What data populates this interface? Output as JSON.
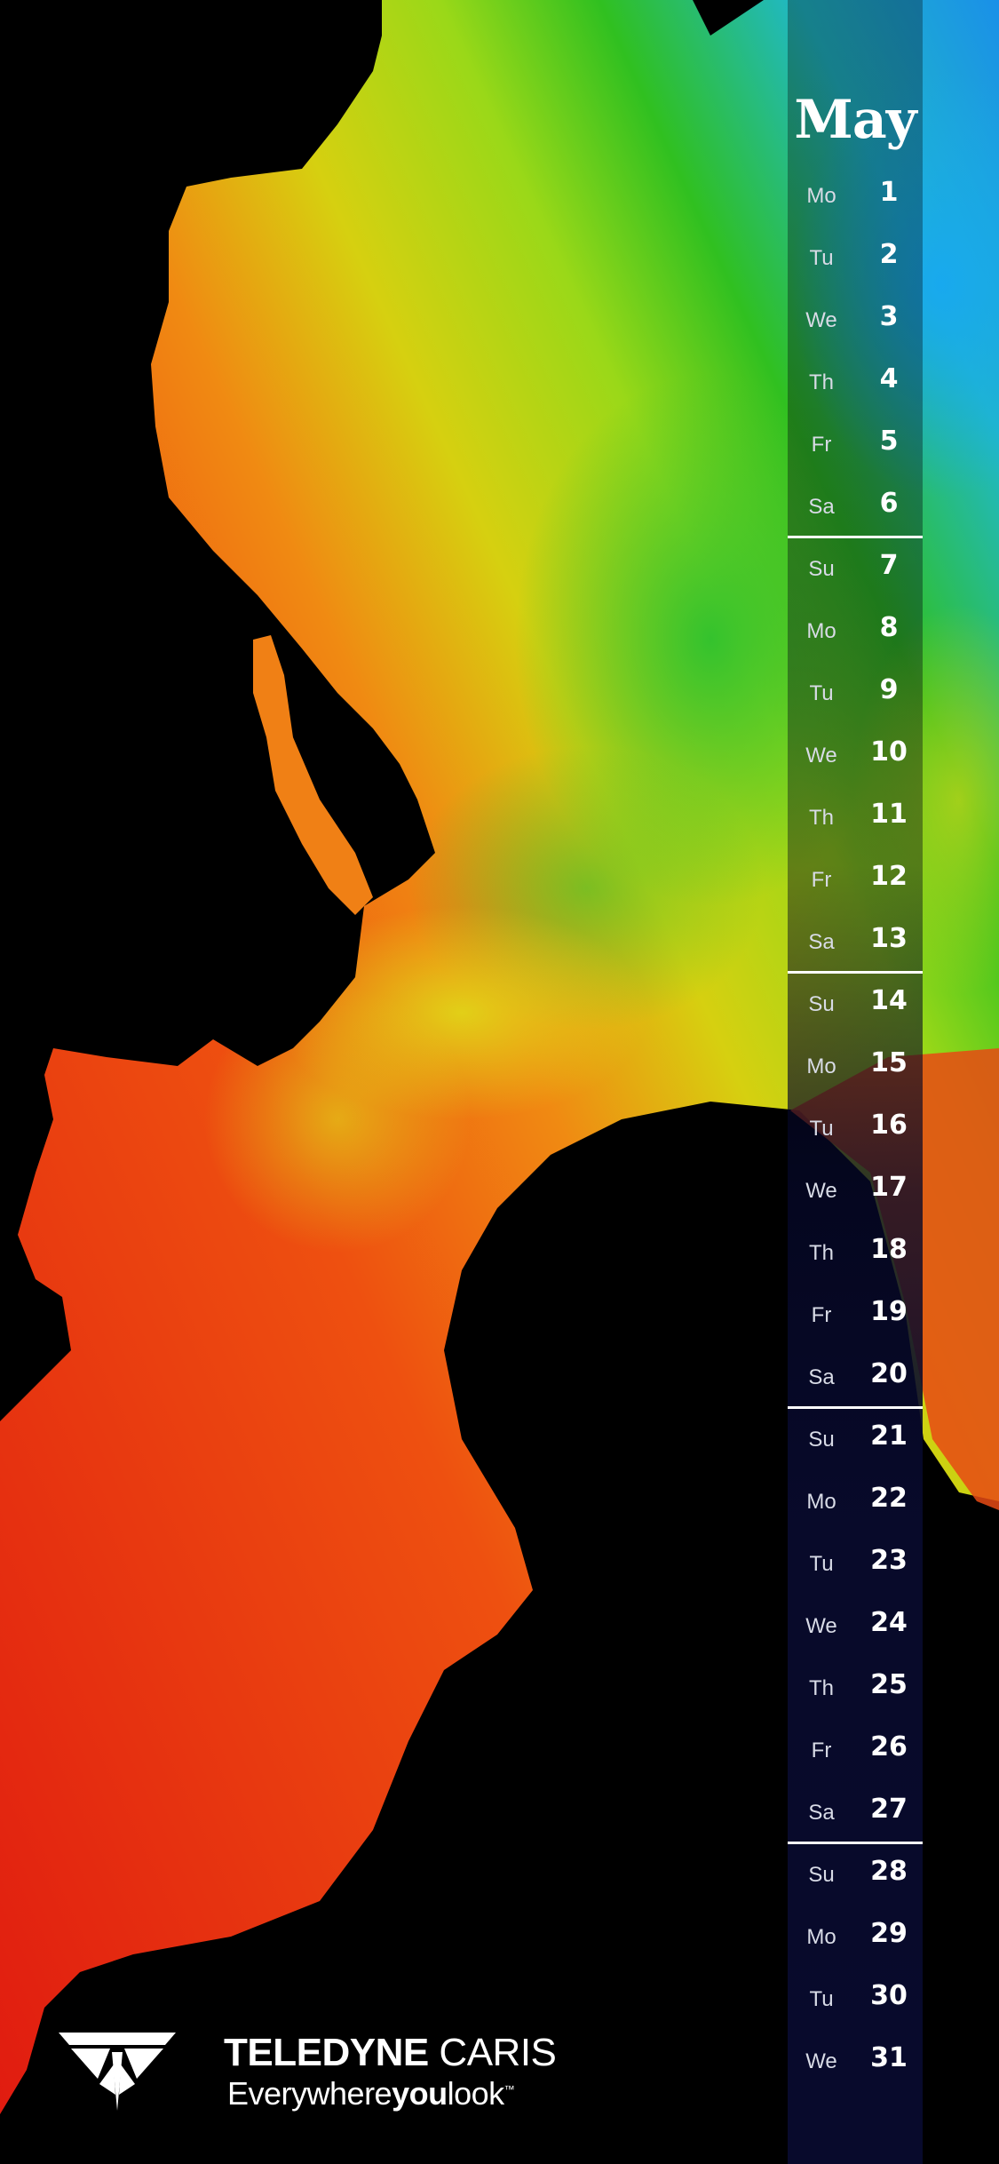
{
  "calendar": {
    "month": "May",
    "weeks": [
      [
        [
          "Mo",
          "1"
        ],
        [
          "Tu",
          "2"
        ],
        [
          "We",
          "3"
        ],
        [
          "Th",
          "4"
        ],
        [
          "Fr",
          "5"
        ],
        [
          "Sa",
          "6"
        ]
      ],
      [
        [
          "Su",
          "7"
        ],
        [
          "Mo",
          "8"
        ],
        [
          "Tu",
          "9"
        ],
        [
          "We",
          "10"
        ],
        [
          "Th",
          "11"
        ],
        [
          "Fr",
          "12"
        ],
        [
          "Sa",
          "13"
        ]
      ],
      [
        [
          "Su",
          "14"
        ],
        [
          "Mo",
          "15"
        ],
        [
          "Tu",
          "16"
        ],
        [
          "We",
          "17"
        ],
        [
          "Th",
          "18"
        ],
        [
          "Fr",
          "19"
        ],
        [
          "Sa",
          "20"
        ]
      ],
      [
        [
          "Su",
          "21"
        ],
        [
          "Mo",
          "22"
        ],
        [
          "Tu",
          "23"
        ],
        [
          "We",
          "24"
        ],
        [
          "Th",
          "25"
        ],
        [
          "Fr",
          "26"
        ],
        [
          "Sa",
          "27"
        ]
      ],
      [
        [
          "Su",
          "28"
        ],
        [
          "Mo",
          "29"
        ],
        [
          "Tu",
          "30"
        ],
        [
          "We",
          "31"
        ]
      ]
    ]
  },
  "brand": {
    "name_bold": "TELEDYNE",
    "name_regular": " CARIS",
    "tagline_pre": "Everywhere",
    "tagline_bold": "you",
    "tagline_post": "look",
    "trademark": "™"
  },
  "colors": {
    "background": "#000000",
    "calendar_dark": "#080a2c",
    "map_red": "#e01a10",
    "map_orange": "#f07a10",
    "map_yellow": "#d8d810",
    "map_green": "#30c020",
    "map_cyan": "#20b8e8"
  }
}
